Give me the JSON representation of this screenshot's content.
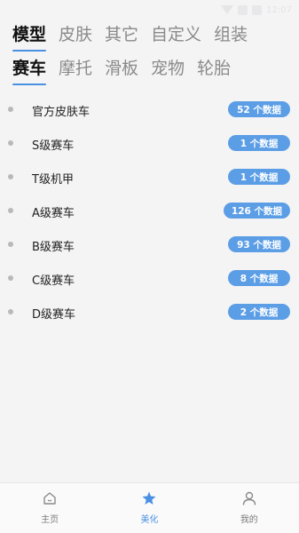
{
  "status_bar": {
    "time": "12:07"
  },
  "tabs": {
    "row1": [
      {
        "label": "模型",
        "active": true
      },
      {
        "label": "皮肤",
        "active": false
      },
      {
        "label": "其它",
        "active": false
      },
      {
        "label": "自定义",
        "active": false
      },
      {
        "label": "组装",
        "active": false
      }
    ],
    "row2": [
      {
        "label": "赛车",
        "active": true
      },
      {
        "label": "摩托",
        "active": false
      },
      {
        "label": "滑板",
        "active": false
      },
      {
        "label": "宠物",
        "active": false
      },
      {
        "label": "轮胎",
        "active": false
      }
    ]
  },
  "list": [
    {
      "label": "官方皮肤车",
      "badge": "52 个数据"
    },
    {
      "label": "S级赛车",
      "badge": "1 个数据"
    },
    {
      "label": "T级机甲",
      "badge": "1 个数据"
    },
    {
      "label": "A级赛车",
      "badge": "126 个数据"
    },
    {
      "label": "B级赛车",
      "badge": "93 个数据"
    },
    {
      "label": "C级赛车",
      "badge": "8 个数据"
    },
    {
      "label": "D级赛车",
      "badge": "2 个数据"
    }
  ],
  "bottom_nav": [
    {
      "label": "主页",
      "icon": "home-icon",
      "active": false
    },
    {
      "label": "美化",
      "icon": "star-icon",
      "active": true
    },
    {
      "label": "我的",
      "icon": "user-icon",
      "active": false
    }
  ],
  "colors": {
    "accent": "#4a90e2",
    "badge": "#5b9ee6"
  }
}
